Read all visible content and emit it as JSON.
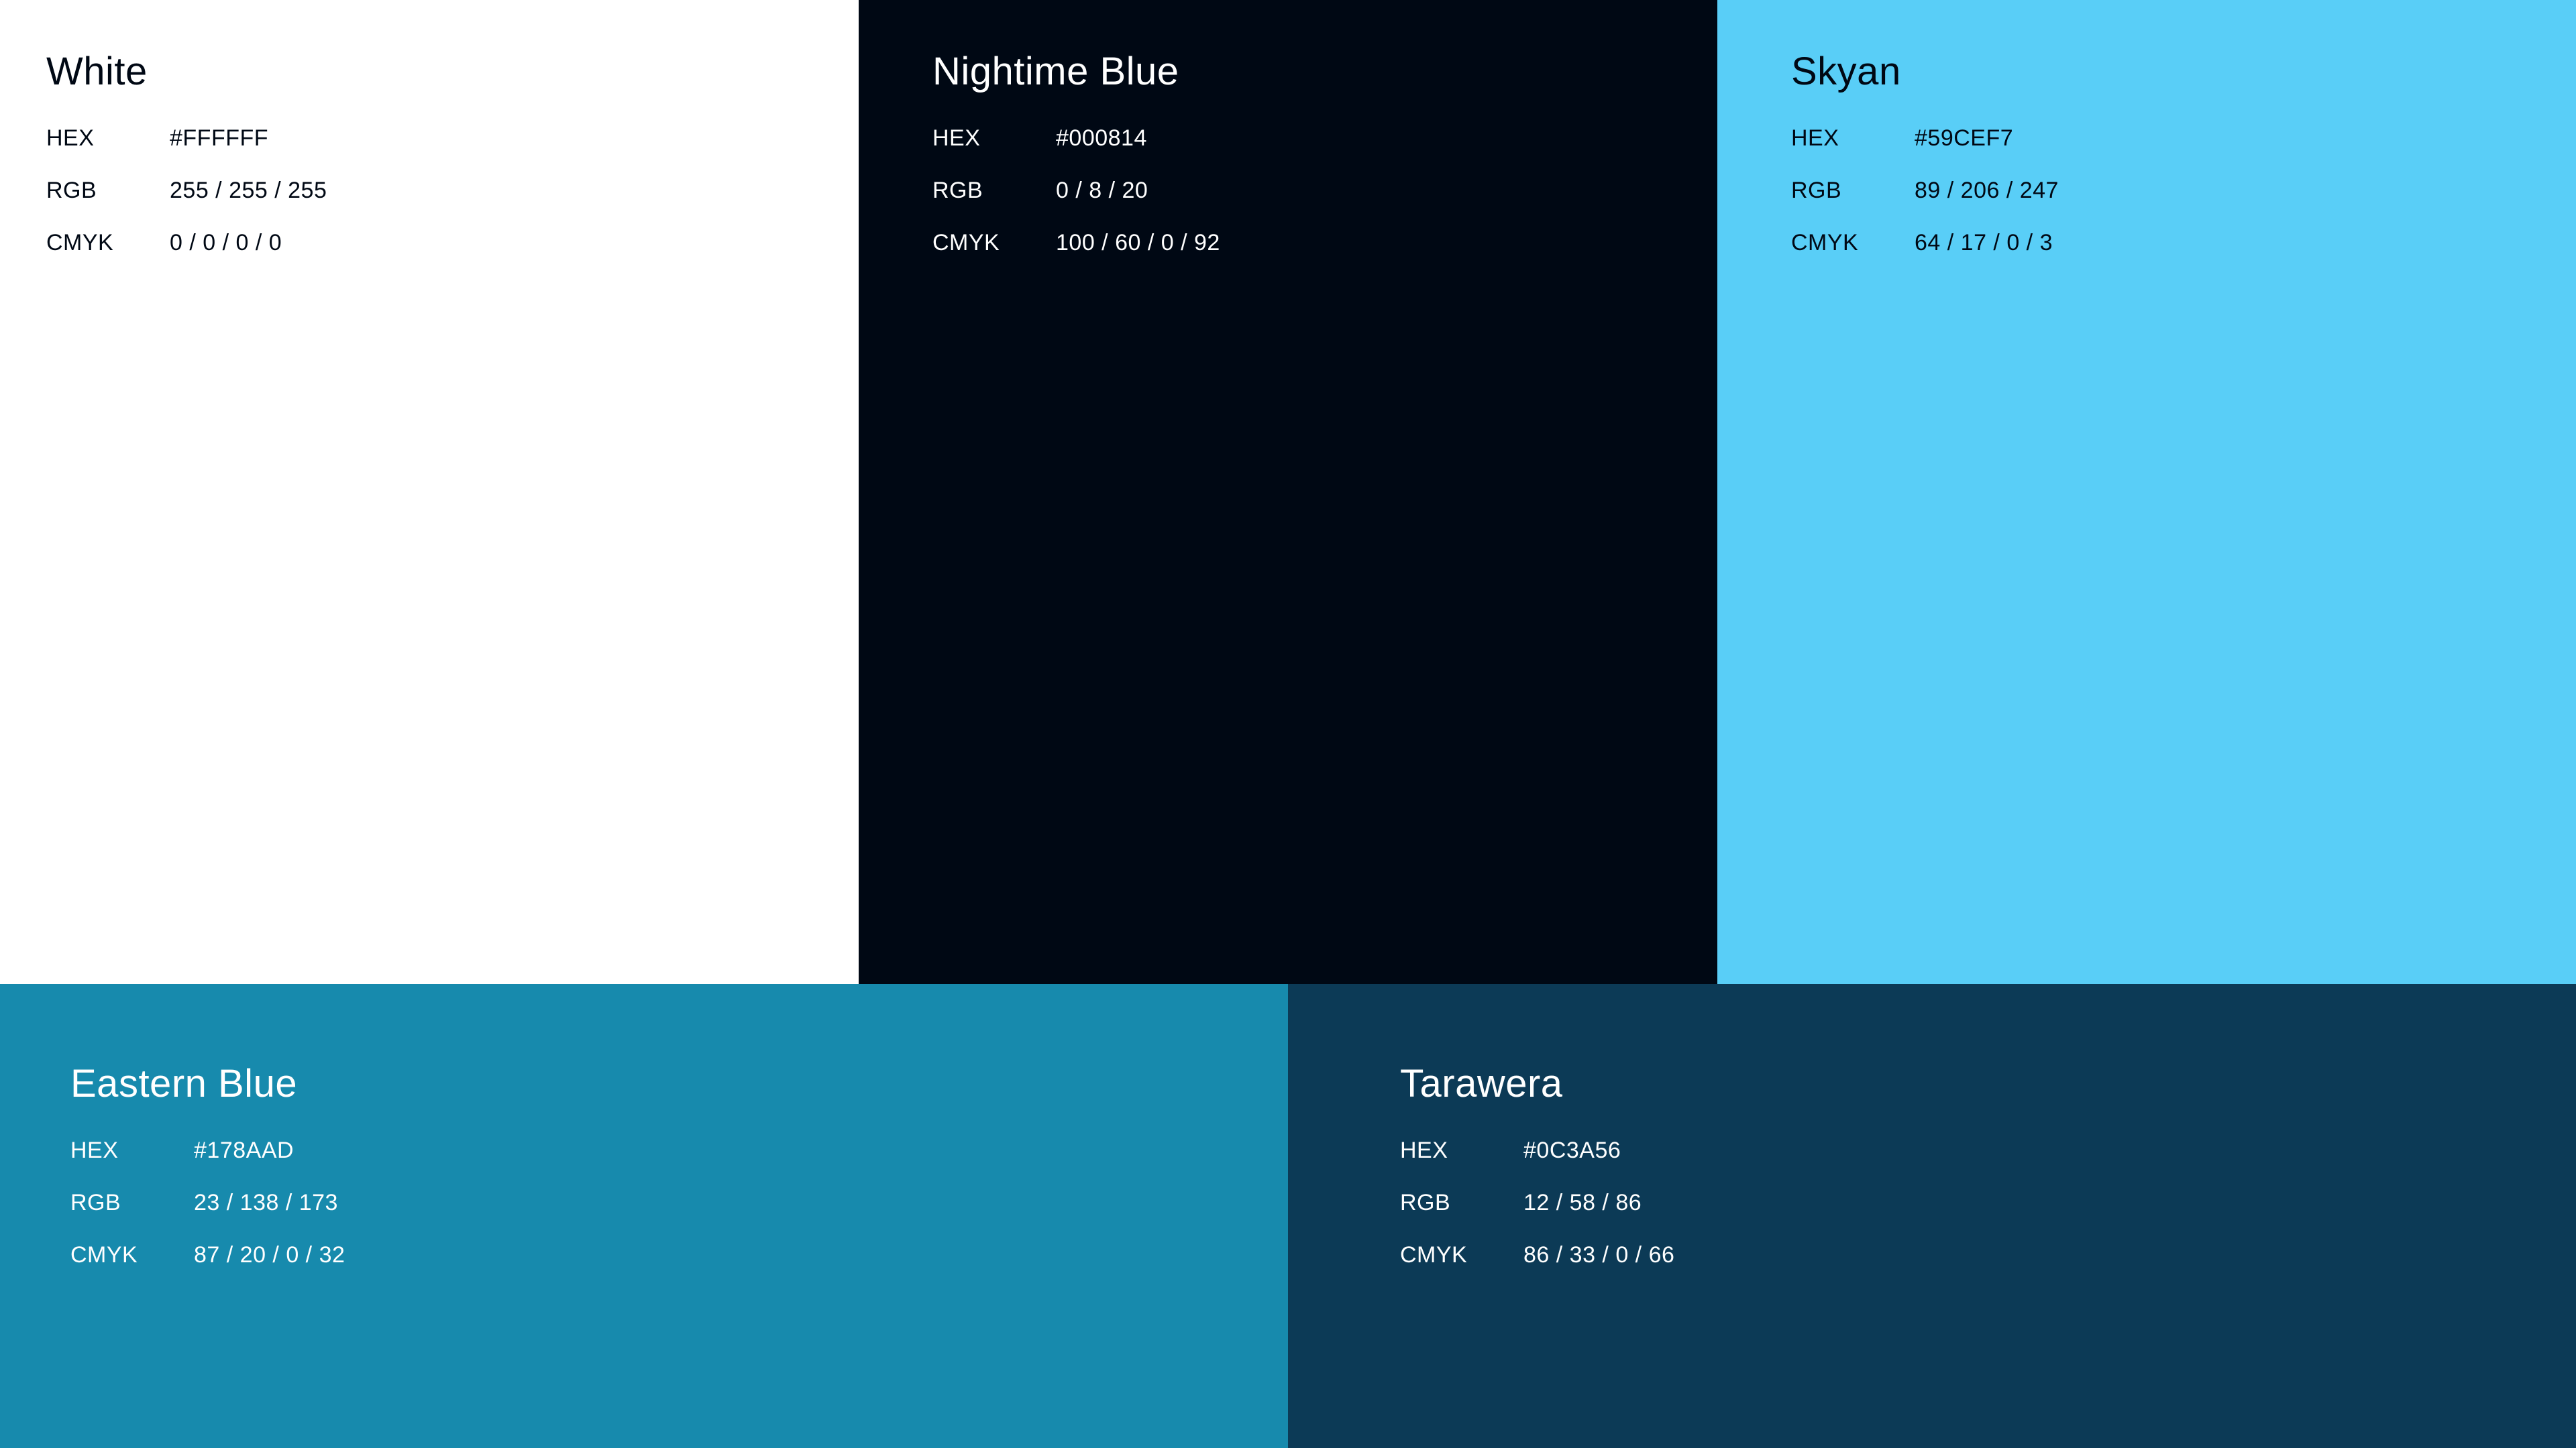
{
  "swatches": [
    {
      "name": "White",
      "bg": "#FFFFFF",
      "text_color": "#000814",
      "hex_label": "HEX",
      "hex": "#FFFFFF",
      "rgb_label": "RGB",
      "rgb": "255 / 255 / 255",
      "cmyk_label": "CMYK",
      "cmyk": "0 / 0 / 0 / 0"
    },
    {
      "name": "Nightime Blue",
      "bg": "#000814",
      "text_color": "#FFFFFF",
      "hex_label": "HEX",
      "hex": "#000814",
      "rgb_label": "RGB",
      "rgb": "0 / 8 / 20",
      "cmyk_label": "CMYK",
      "cmyk": "100 / 60 / 0 / 92"
    },
    {
      "name": "Skyan",
      "bg": "#59CEF7",
      "text_color": "#000814",
      "hex_label": "HEX",
      "hex": "#59CEF7",
      "rgb_label": "RGB",
      "rgb": "89 / 206 / 247",
      "cmyk_label": "CMYK",
      "cmyk": "64 / 17 / 0 / 3"
    },
    {
      "name": "Eastern Blue",
      "bg": "#178AAD",
      "text_color": "#FFFFFF",
      "hex_label": "HEX",
      "hex": "#178AAD",
      "rgb_label": "RGB",
      "rgb": "23 / 138 / 173",
      "cmyk_label": "CMYK",
      "cmyk": "87 / 20 / 0 / 32"
    },
    {
      "name": "Tarawera",
      "bg": "#0C3A56",
      "text_color": "#FFFFFF",
      "hex_label": "HEX",
      "hex": "#0C3A56",
      "rgb_label": "RGB",
      "rgb": "12 / 58 / 86",
      "cmyk_label": "CMYK",
      "cmyk": "86 / 33 / 0 / 66"
    }
  ]
}
